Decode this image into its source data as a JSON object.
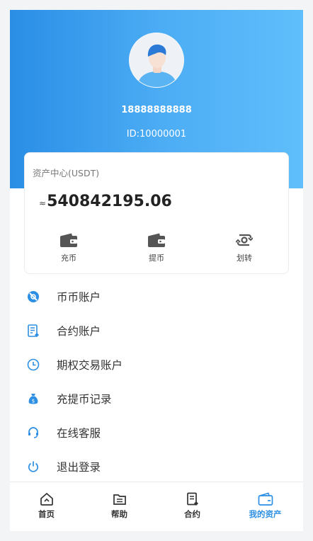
{
  "profile": {
    "username": "18888888888",
    "user_id": "ID:10000001"
  },
  "asset_card": {
    "title": "资产中心(USDT)",
    "approx_symbol": "≈",
    "amount": "540842195.06",
    "actions": [
      {
        "label": "充币",
        "icon": "wallet-icon"
      },
      {
        "label": "提币",
        "icon": "wallet-icon"
      },
      {
        "label": "划转",
        "icon": "transfer-icon"
      }
    ]
  },
  "menu": [
    {
      "label": "币币账户",
      "icon": "coin-account-icon"
    },
    {
      "label": "合约账户",
      "icon": "contract-doc-icon"
    },
    {
      "label": "期权交易账户",
      "icon": "clock-icon"
    },
    {
      "label": "充提币记录",
      "icon": "money-bag-icon"
    },
    {
      "label": "在线客服",
      "icon": "headset-icon"
    },
    {
      "label": "退出登录",
      "icon": "power-icon"
    }
  ],
  "tabbar": [
    {
      "label": "首页",
      "icon": "home-icon",
      "active": false
    },
    {
      "label": "帮助",
      "icon": "help-folder-icon",
      "active": false
    },
    {
      "label": "合约",
      "icon": "contract-icon",
      "active": false
    },
    {
      "label": "我的资产",
      "icon": "wallet-icon",
      "active": true
    }
  ],
  "colors": {
    "accent": "#2c8fe3",
    "header_gradient_start": "#2a8ee6",
    "header_gradient_end": "#5fbefb"
  }
}
